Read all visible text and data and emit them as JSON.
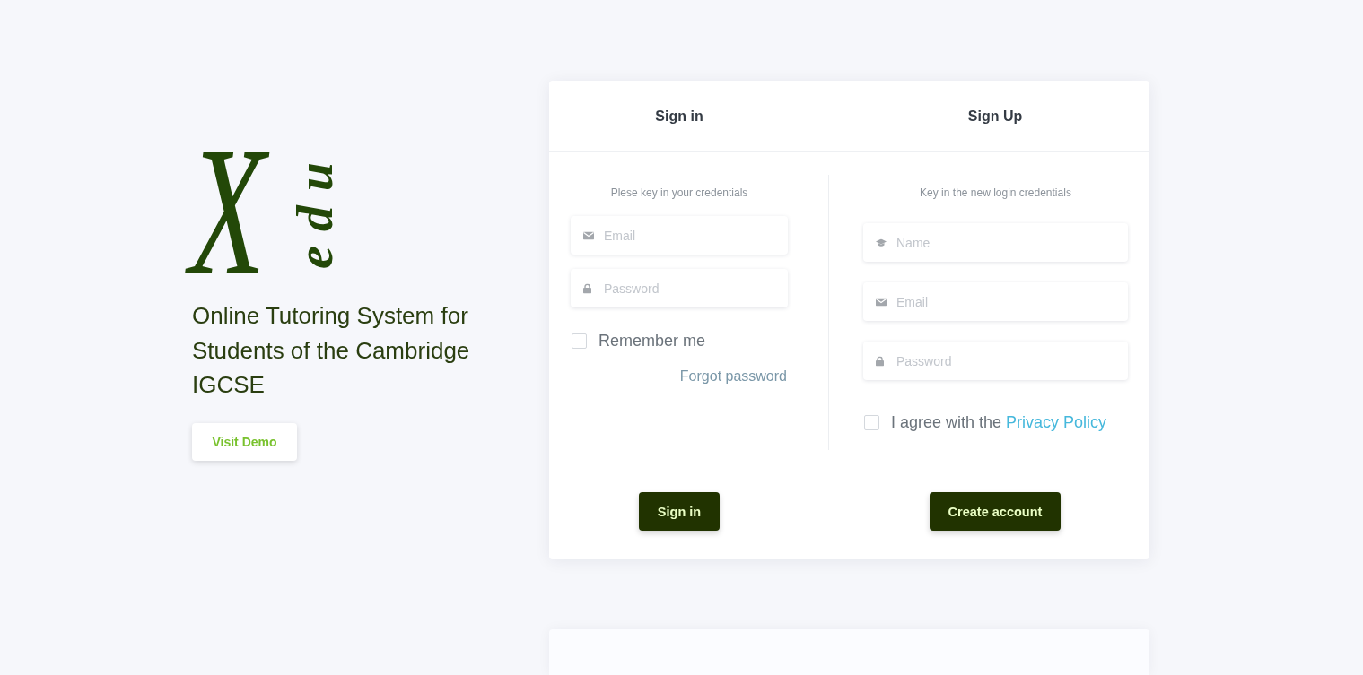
{
  "brand": {
    "logo_letter": "X",
    "logo_suffix": "edu",
    "tagline": "Online Tutoring System for Students of the Cambridge IGCSE",
    "demo_button": "Visit Demo"
  },
  "sign_in": {
    "title": "Sign in",
    "subtitle": "Plese key in your credentials",
    "fields": [
      {
        "kind": "email",
        "placeholder": "Email"
      },
      {
        "kind": "password",
        "placeholder": "Password"
      }
    ],
    "remember": {
      "label": "Remember me",
      "checked": false
    },
    "forgot_link": "Forgot password",
    "button": "Sign in"
  },
  "sign_up": {
    "title": "Sign Up",
    "subtitle": "Key in the new login credentials",
    "fields": [
      {
        "kind": "name",
        "placeholder": "Name"
      },
      {
        "kind": "email",
        "placeholder": "Email"
      },
      {
        "kind": "password",
        "placeholder": "Password"
      }
    ],
    "agree": {
      "label": "I agree with the",
      "link": "Privacy Policy",
      "checked": false
    },
    "button": "Create account"
  }
}
